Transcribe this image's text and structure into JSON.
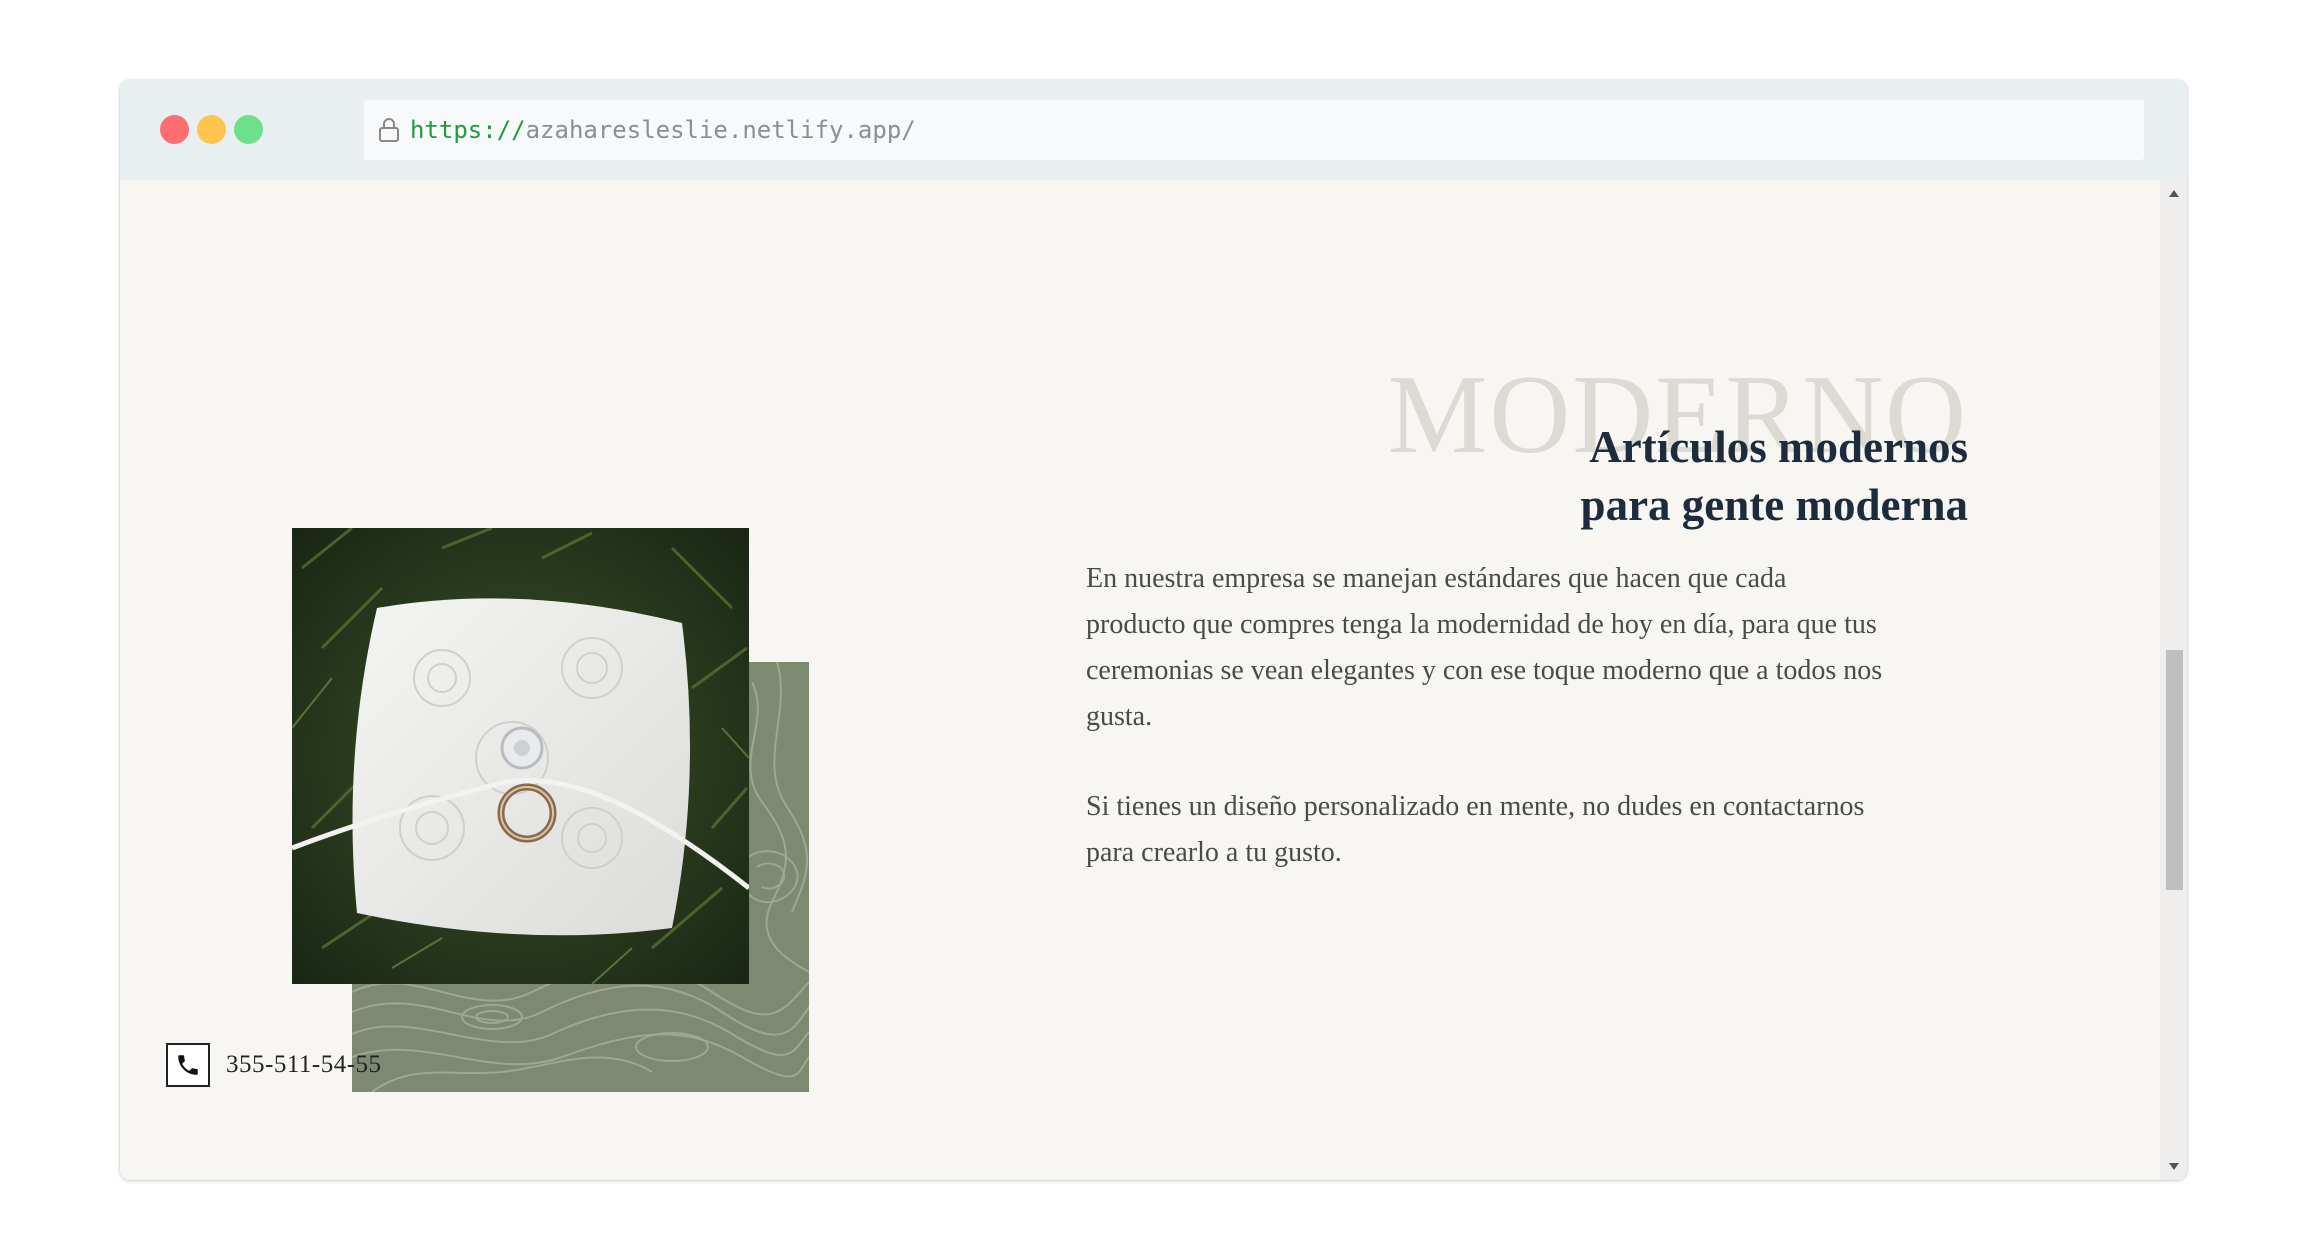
{
  "browser": {
    "url_scheme": "https://",
    "url_host": "azaharesleslie.netlify.app/"
  },
  "section": {
    "background_word": "MODERNO",
    "heading_line1": "Artículos modernos",
    "heading_line2": "para gente moderna",
    "paragraph1": "En nuestra empresa se manejan estándares que hacen que cada producto que compres tenga la modernidad de hoy en día, para que tus ceremonias se vean elegantes y con ese toque moderno que a todos nos gusta.",
    "paragraph2": "Si tienes un diseño personalizado en mente, no dudes en contactarnos para crearlo a tu gusto."
  },
  "contact": {
    "phone": "355-511-54-55",
    "icon": "phone-icon"
  },
  "colors": {
    "heading": "#1d2c3d",
    "background_word": "#dddad4",
    "accent_block": "#7d8971",
    "page_background": "#f7f6f3"
  }
}
